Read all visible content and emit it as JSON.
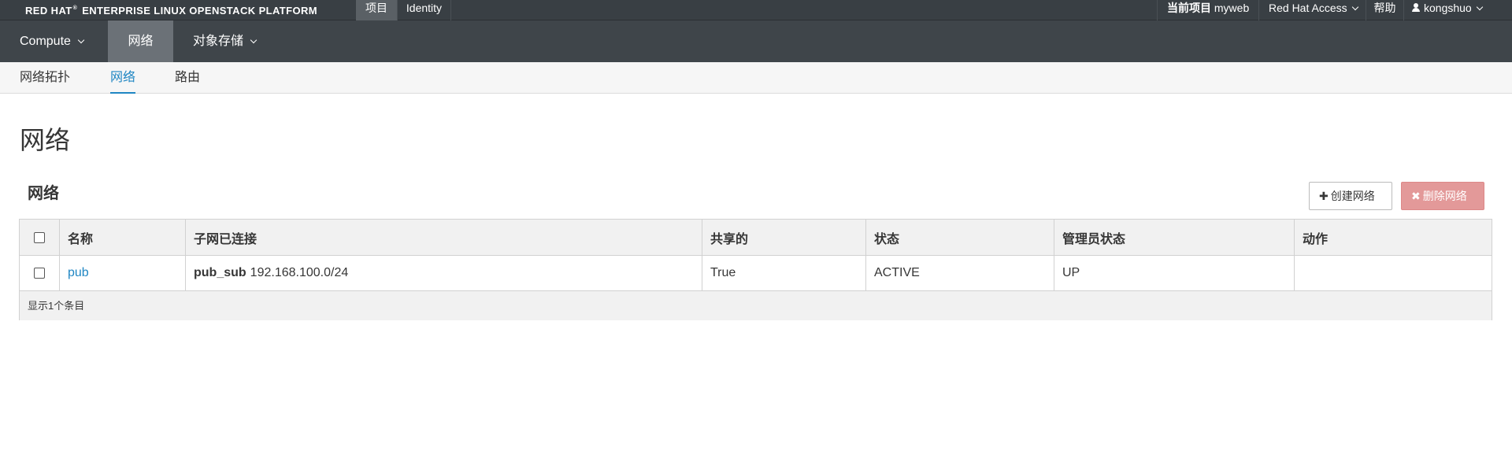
{
  "topbar": {
    "brand": "RED HAT",
    "brand_mark": "®",
    "brand_rest": "ENTERPRISE LINUX OPENSTACK PLATFORM",
    "project_tab": "项目",
    "identity_tab": "Identity",
    "current_project_label": "当前项目",
    "current_project_value": "myweb",
    "red_hat_access": "Red Hat Access",
    "help": "帮助",
    "user": "kongshuo"
  },
  "mainnav": {
    "compute": "Compute",
    "network": "网络",
    "object_storage": "对象存储"
  },
  "subnav": {
    "topology": "网络拓扑",
    "networks": "网络",
    "routers": "路由"
  },
  "page": {
    "title": "网络",
    "section_title": "网络",
    "create_button": "创建网络",
    "delete_button": "删除网络"
  },
  "table": {
    "headers": [
      "名称",
      "子网已连接",
      "共享的",
      "状态",
      "管理员状态",
      "动作"
    ],
    "rows": [
      {
        "name": "pub",
        "subnet_name": "pub_sub",
        "subnet_cidr": "192.168.100.0/24",
        "shared": "True",
        "status": "ACTIVE",
        "admin_state": "UP",
        "actions": ""
      }
    ],
    "footer": "显示1个条目"
  },
  "colors": {
    "topbar_bg": "#393f44",
    "mainnav_bg": "#3f454a",
    "mainnav_active": "#6b7177",
    "link": "#1f86c3",
    "delete_button": "#e39999"
  }
}
